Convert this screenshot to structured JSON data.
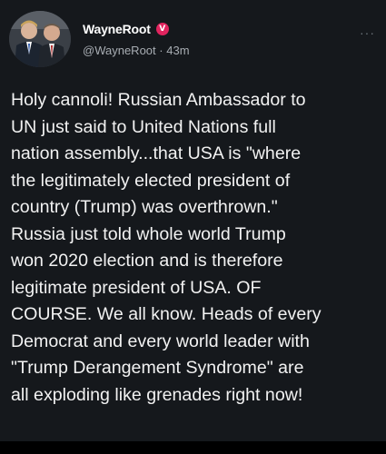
{
  "author": {
    "display_name": "WayneRoot",
    "verified_mark": "V",
    "handle": "@WayneRoot",
    "separator": "·",
    "time": "43m"
  },
  "menu": {
    "more_label": "···"
  },
  "tweet": {
    "lines": [
      "Holy cannoli! Russian Ambassador to",
      "UN just said to United Nations full",
      "nation assembly...that USA is \"where",
      "the legitimately elected president of",
      "country (Trump) was overthrown.\"",
      "Russia just told whole world Trump",
      "won 2020 election and is therefore",
      "legitimate president of USA. OF",
      "COURSE. We all know. Heads of every",
      "Democrat and every world leader with",
      "\"Trump Derangement Syndrome\" are",
      "all exploding like grenades right now!"
    ]
  },
  "colors": {
    "background": "#15181c",
    "text": "#f2f2f2",
    "secondary_text": "#a8adb3",
    "verified_badge": "#e0245e"
  }
}
